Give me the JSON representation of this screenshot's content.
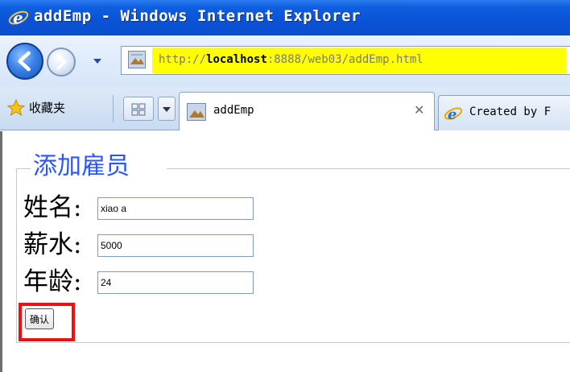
{
  "window": {
    "title": "addEmp - Windows Internet Explorer"
  },
  "address_bar": {
    "url_prefix": "http://",
    "url_host": "localhost",
    "url_rest": ":8888/web03/addEmp.html"
  },
  "favorites": {
    "label": "收藏夹"
  },
  "tabs": [
    {
      "label": "addEmp",
      "active": true,
      "close_glyph": "✕"
    },
    {
      "label": "Created by F",
      "active": false
    }
  ],
  "form": {
    "legend": "添加雇员",
    "fields": [
      {
        "label": "姓名:",
        "value": "xiao a"
      },
      {
        "label": "薪水:",
        "value": "5000"
      },
      {
        "label": "年龄:",
        "value": "24"
      }
    ],
    "submit_label": "确认"
  },
  "colors": {
    "titlebar": "#0b4fcf",
    "legend_text": "#2a55ff",
    "url_highlight": "#ffff00",
    "annotation_box": "#ee1010"
  },
  "icons": {
    "title": "ie-logo-icon",
    "back": "back-arrow-icon",
    "forward": "forward-arrow-icon",
    "favorites": "favorites-star-icon",
    "quick_tabs": "quick-tabs-icon",
    "page": "page-favicon-icon"
  }
}
